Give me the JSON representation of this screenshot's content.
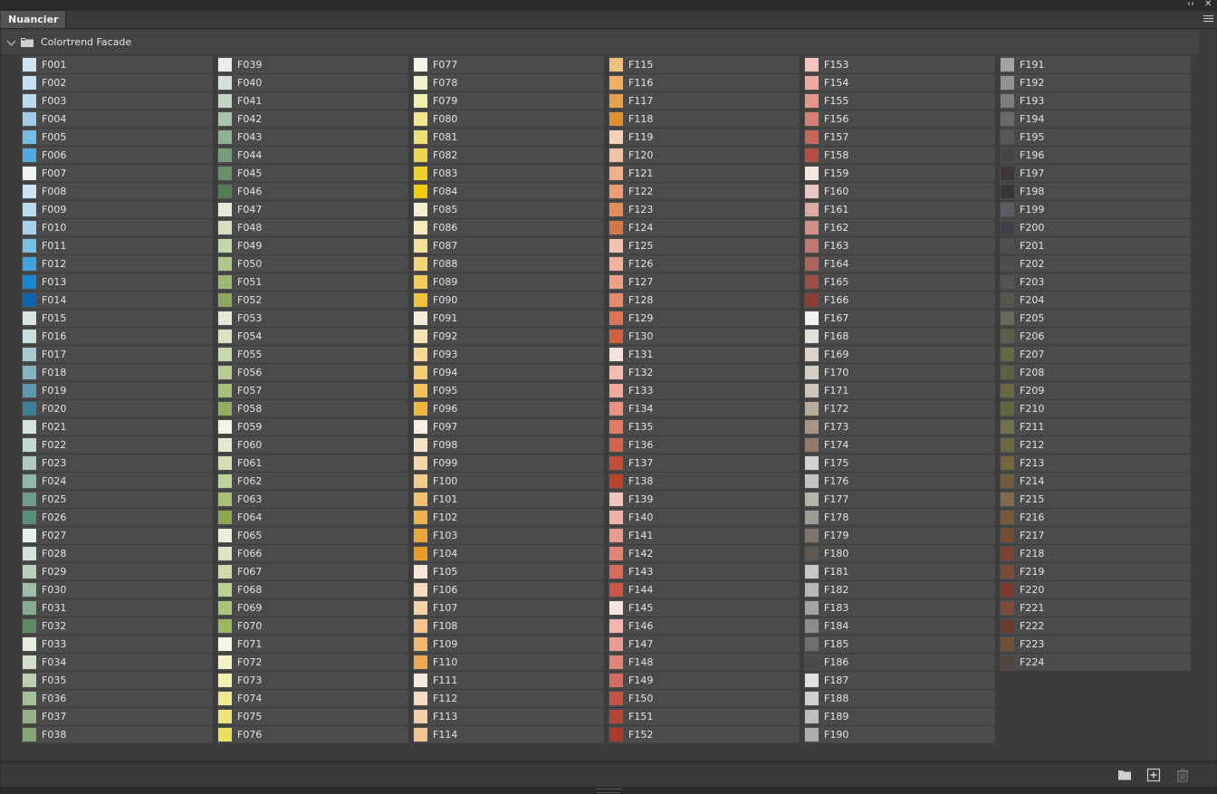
{
  "panel": {
    "tab_label": "Nuancier",
    "collapse_glyph": "‹‹",
    "close_glyph": "✕"
  },
  "group": {
    "name": "Colortrend Facade"
  },
  "icons": {
    "folder": "folder-icon",
    "new_swatch": "new-swatch-icon",
    "trash": "trash-icon",
    "menu": "panel-menu-icon"
  },
  "swatch_columns": [
    [
      [
        "F001",
        "#cfe4f3"
      ],
      [
        "F002",
        "#c6e0f1"
      ],
      [
        "F003",
        "#b9daef"
      ],
      [
        "F004",
        "#9dcdea"
      ],
      [
        "F005",
        "#77bce4"
      ],
      [
        "F006",
        "#52abdf"
      ],
      [
        "F007",
        "#eef3f4"
      ],
      [
        "F008",
        "#cfe4f3"
      ],
      [
        "F009",
        "#b9daef"
      ],
      [
        "F010",
        "#a8d2ec"
      ],
      [
        "F011",
        "#78bee5"
      ],
      [
        "F012",
        "#3fa3dc"
      ],
      [
        "F013",
        "#1888d2"
      ],
      [
        "F014",
        "#0c67b3"
      ],
      [
        "F015",
        "#d9e6e6"
      ],
      [
        "F016",
        "#cbdedf"
      ],
      [
        "F017",
        "#a9c9d0"
      ],
      [
        "F018",
        "#86b3c0"
      ],
      [
        "F019",
        "#5e98ad"
      ],
      [
        "F020",
        "#3e7e97"
      ],
      [
        "F021",
        "#d3e2de"
      ],
      [
        "F022",
        "#c3d8d2"
      ],
      [
        "F023",
        "#adcbc1"
      ],
      [
        "F024",
        "#90b8a9"
      ],
      [
        "F025",
        "#6e9e8a"
      ],
      [
        "F026",
        "#5a8f77"
      ],
      [
        "F027",
        "#e8f0ea"
      ],
      [
        "F028",
        "#d2e2d6"
      ],
      [
        "F029",
        "#b6d0bc"
      ],
      [
        "F030",
        "#9dbea5"
      ],
      [
        "F031",
        "#86ab8d"
      ],
      [
        "F032",
        "#5e8a64"
      ],
      [
        "F033",
        "#e4ecdc"
      ],
      [
        "F034",
        "#d3e0cb"
      ],
      [
        "F035",
        "#bccfb1"
      ],
      [
        "F036",
        "#a6bf99"
      ],
      [
        "F037",
        "#94b187"
      ],
      [
        "F038",
        "#86a676"
      ]
    ],
    [
      [
        "F039",
        "#e8f0ea"
      ],
      [
        "F040",
        "#d3e2d6"
      ],
      [
        "F041",
        "#c0d5c3"
      ],
      [
        "F042",
        "#a9c4ac"
      ],
      [
        "F043",
        "#90b192"
      ],
      [
        "F044",
        "#789d7a"
      ],
      [
        "F045",
        "#6a8f6b"
      ],
      [
        "F046",
        "#567c56"
      ],
      [
        "F047",
        "#e2ebd7"
      ],
      [
        "F048",
        "#d3e0c2"
      ],
      [
        "F049",
        "#c4d6a9"
      ],
      [
        "F050",
        "#adc78a"
      ],
      [
        "F051",
        "#9dba75"
      ],
      [
        "F052",
        "#8ca85f"
      ],
      [
        "F053",
        "#e4ebd7"
      ],
      [
        "F054",
        "#d8e3c2"
      ],
      [
        "F055",
        "#c8d9ad"
      ],
      [
        "F056",
        "#b7cd93"
      ],
      [
        "F057",
        "#a6c07a"
      ],
      [
        "F058",
        "#93ad5f"
      ],
      [
        "F059",
        "#f1f4e8"
      ],
      [
        "F060",
        "#e0ebcf"
      ],
      [
        "F061",
        "#cfdfb3"
      ],
      [
        "F062",
        "#bdd398"
      ],
      [
        "F063",
        "#a6c176"
      ],
      [
        "F064",
        "#8ca84e"
      ],
      [
        "F065",
        "#e8f0d8"
      ],
      [
        "F066",
        "#dbe6c3"
      ],
      [
        "F067",
        "#ccdcab"
      ],
      [
        "F068",
        "#bcd092"
      ],
      [
        "F069",
        "#aac478"
      ],
      [
        "F070",
        "#9ab85e"
      ],
      [
        "F071",
        "#f6f7e6"
      ],
      [
        "F072",
        "#f2f2c6"
      ],
      [
        "F073",
        "#f2f0ad"
      ],
      [
        "F074",
        "#efea92"
      ],
      [
        "F075",
        "#eee57a"
      ],
      [
        "F076",
        "#ecdf5f"
      ]
    ],
    [
      [
        "F077",
        "#f4f4e6"
      ],
      [
        "F078",
        "#f3f2c9"
      ],
      [
        "F079",
        "#f1efae"
      ],
      [
        "F080",
        "#efe891"
      ],
      [
        "F081",
        "#ede072"
      ],
      [
        "F082",
        "#ecd64f"
      ],
      [
        "F083",
        "#efd12b"
      ],
      [
        "F084",
        "#f2cd07"
      ],
      [
        "F085",
        "#f6f0d3"
      ],
      [
        "F086",
        "#f5ebbd"
      ],
      [
        "F087",
        "#f2e09a"
      ],
      [
        "F088",
        "#f1d675"
      ],
      [
        "F089",
        "#f2cc57"
      ],
      [
        "F090",
        "#f2c23b"
      ],
      [
        "F091",
        "#f7ecd4"
      ],
      [
        "F092",
        "#f7e3b6"
      ],
      [
        "F093",
        "#f5d994"
      ],
      [
        "F094",
        "#f4cd75"
      ],
      [
        "F095",
        "#f3c25a"
      ],
      [
        "F096",
        "#f1b63a"
      ],
      [
        "F097",
        "#f7f0e4"
      ],
      [
        "F098",
        "#f7e3c6"
      ],
      [
        "F099",
        "#f5d8a9"
      ],
      [
        "F100",
        "#f3cc8b"
      ],
      [
        "F101",
        "#f1c070"
      ],
      [
        "F102",
        "#eeb04d"
      ],
      [
        "F103",
        "#eba63b"
      ],
      [
        "F104",
        "#e99b29"
      ],
      [
        "F105",
        "#f7e6d4"
      ],
      [
        "F106",
        "#f7dcbe"
      ],
      [
        "F107",
        "#f5d1a7"
      ],
      [
        "F108",
        "#f3c48c"
      ],
      [
        "F109",
        "#f1b670"
      ],
      [
        "F110",
        "#eea752"
      ],
      [
        "F111",
        "#f4ecde"
      ],
      [
        "F112",
        "#f3dcc1"
      ],
      [
        "F113",
        "#f2cfa7"
      ],
      [
        "F114",
        "#f2c493"
      ]
    ],
    [
      [
        "F115",
        "#f2c07d"
      ],
      [
        "F116",
        "#efb066"
      ],
      [
        "F117",
        "#e9a04a"
      ],
      [
        "F118",
        "#e08f2f"
      ],
      [
        "F119",
        "#f6d1b5"
      ],
      [
        "F120",
        "#f3c2a4"
      ],
      [
        "F121",
        "#f0b08c"
      ],
      [
        "F122",
        "#eb9d72"
      ],
      [
        "F123",
        "#e38c5c"
      ],
      [
        "F124",
        "#d6774a"
      ],
      [
        "F125",
        "#f4c2b2"
      ],
      [
        "F126",
        "#f1b29c"
      ],
      [
        "F127",
        "#ee9f85"
      ],
      [
        "F128",
        "#e88a6d"
      ],
      [
        "F129",
        "#de7455"
      ],
      [
        "F130",
        "#cf6140"
      ],
      [
        "F131",
        "#f6e1dc"
      ],
      [
        "F132",
        "#f3bcb0"
      ],
      [
        "F133",
        "#f0aa9c"
      ],
      [
        "F134",
        "#ea9280"
      ],
      [
        "F135",
        "#e27c67"
      ],
      [
        "F136",
        "#d2654e"
      ],
      [
        "F137",
        "#c24e37"
      ],
      [
        "F138",
        "#b8442c"
      ],
      [
        "F139",
        "#f3c4bd"
      ],
      [
        "F140",
        "#efb1a8"
      ],
      [
        "F141",
        "#ea9a8f"
      ],
      [
        "F142",
        "#e28373"
      ],
      [
        "F143",
        "#d66b5a"
      ],
      [
        "F144",
        "#c85545"
      ],
      [
        "F145",
        "#f6e3df"
      ],
      [
        "F146",
        "#f0b5ac"
      ],
      [
        "F147",
        "#e99c92"
      ],
      [
        "F148",
        "#e08579"
      ],
      [
        "F149",
        "#d36b5e"
      ],
      [
        "F150",
        "#c25546"
      ],
      [
        "F151",
        "#b44637"
      ],
      [
        "F152",
        "#a93a2c"
      ]
    ],
    [
      [
        "F153",
        "#f2c2bc"
      ],
      [
        "F154",
        "#ecaaa2"
      ],
      [
        "F155",
        "#e4958c"
      ],
      [
        "F156",
        "#d47e74"
      ],
      [
        "F157",
        "#c6665b"
      ],
      [
        "F158",
        "#b14f44"
      ],
      [
        "F159",
        "#f5e6e4"
      ],
      [
        "F160",
        "#eac7c2"
      ],
      [
        "F161",
        "#deaba4"
      ],
      [
        "F162",
        "#d09189"
      ],
      [
        "F163",
        "#bd786f"
      ],
      [
        "F164",
        "#ab635a"
      ],
      [
        "F165",
        "#9b5047"
      ],
      [
        "F166",
        "#8c3f36"
      ],
      [
        "F167",
        "#f2f1ee"
      ],
      [
        "F168",
        "#e4e1da"
      ],
      [
        "F169",
        "#d9d3ca"
      ],
      [
        "F170",
        "#d4cec5"
      ],
      [
        "F171",
        "#cdc4ba"
      ],
      [
        "F172",
        "#b9ab9e"
      ],
      [
        "F173",
        "#a89585"
      ],
      [
        "F174",
        "#917a6b"
      ],
      [
        "F175",
        "#d4d3cf"
      ],
      [
        "F176",
        "#c5c3bf"
      ],
      [
        "F177",
        "#b6b2ac"
      ],
      [
        "F178",
        "#9f9a93"
      ],
      [
        "F179",
        "#7c766f"
      ],
      [
        "F180",
        "#5e5851"
      ],
      [
        "F181",
        "#c7c7c7"
      ],
      [
        "F182",
        "#b7b7b7"
      ],
      [
        "F183",
        "#a3a3a3"
      ],
      [
        "F184",
        "#8c8c8c"
      ],
      [
        "F185",
        "#6f6f6f"
      ],
      [
        "F186",
        "#4a4a4a"
      ],
      [
        "F187",
        "#e2e2e2"
      ],
      [
        "F188",
        "#d0d0d0"
      ],
      [
        "F189",
        "#bfbfbf"
      ],
      [
        "F190",
        "#adadad"
      ]
    ],
    [
      [
        "F191",
        "#a3a3a3"
      ],
      [
        "F192",
        "#929292"
      ],
      [
        "F193",
        "#7e7e7e"
      ],
      [
        "F194",
        "#6a6a6a"
      ],
      [
        "F195",
        "#575757"
      ],
      [
        "F196",
        "#454545"
      ],
      [
        "F197",
        "#3d3838"
      ],
      [
        "F198",
        "#383533"
      ],
      [
        "F199",
        "#5a5d62"
      ],
      [
        "F200",
        "#3d424a"
      ],
      [
        "F201",
        "#4c5250"
      ],
      [
        "F202",
        "#4a504a"
      ],
      [
        "F203",
        "#4e574e"
      ],
      [
        "F204",
        "#4f5a4a"
      ],
      [
        "F205",
        "#666b60"
      ],
      [
        "F206",
        "#5a5f4a"
      ],
      [
        "F207",
        "#656845"
      ],
      [
        "F208",
        "#5c6141"
      ],
      [
        "F209",
        "#676a45"
      ],
      [
        "F210",
        "#5f6a3f"
      ],
      [
        "F211",
        "#737050"
      ],
      [
        "F212",
        "#6c673e"
      ],
      [
        "F213",
        "#75673d"
      ],
      [
        "F214",
        "#725e3a"
      ],
      [
        "F215",
        "#806b50"
      ],
      [
        "F216",
        "#785a3a"
      ],
      [
        "F217",
        "#774b36"
      ],
      [
        "F218",
        "#7c4233"
      ],
      [
        "F219",
        "#7e4a3c"
      ],
      [
        "F220",
        "#7d3a2d"
      ],
      [
        "F221",
        "#7c4a3a"
      ],
      [
        "F222",
        "#6b3a2f"
      ],
      [
        "F223",
        "#6e523a"
      ],
      [
        "F224",
        "#4e4540"
      ]
    ]
  ]
}
